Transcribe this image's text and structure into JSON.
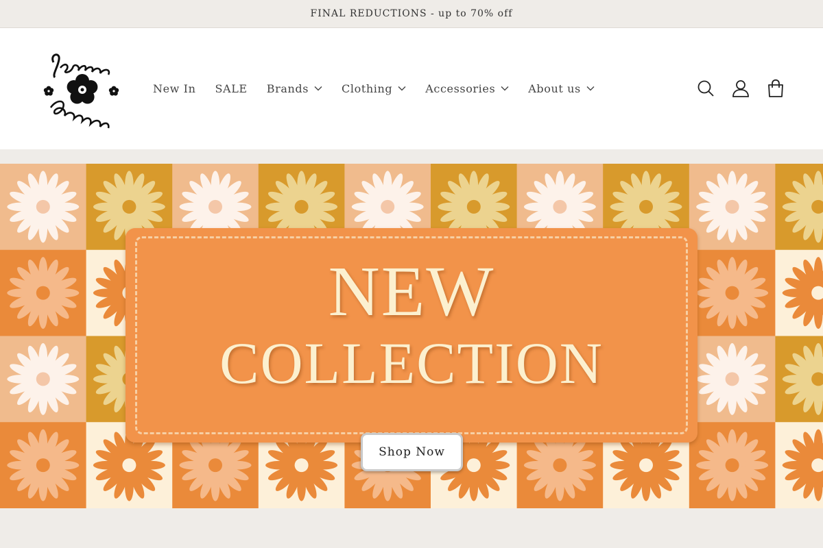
{
  "announcement": {
    "text": "FINAL REDUCTIONS - up to 70% off"
  },
  "logo": {
    "alt_text": "Jasmine Boutique",
    "line1": "Jasmine",
    "line2": "Boutique"
  },
  "nav": {
    "items": [
      {
        "label": "New In",
        "has_dropdown": false
      },
      {
        "label": "SALE",
        "has_dropdown": false
      },
      {
        "label": "Brands",
        "has_dropdown": true
      },
      {
        "label": "Clothing",
        "has_dropdown": true
      },
      {
        "label": "Accessories",
        "has_dropdown": true
      },
      {
        "label": "About us",
        "has_dropdown": true
      }
    ]
  },
  "header_icons": [
    "search-icon",
    "account-icon",
    "cart-icon"
  ],
  "hero": {
    "headline_line1": "NEW",
    "headline_line2": "COLLECTION",
    "cta_label": "Shop Now"
  },
  "colors": {
    "announcement_bg": "#efece8",
    "patch": "#f2934a",
    "headline_text": "#fcf0cf",
    "tile_mustard": "#d89a2c",
    "tile_peach": "#f0bb8d",
    "tile_orange": "#ea8a3a",
    "tile_cream": "#fdf0d9"
  }
}
